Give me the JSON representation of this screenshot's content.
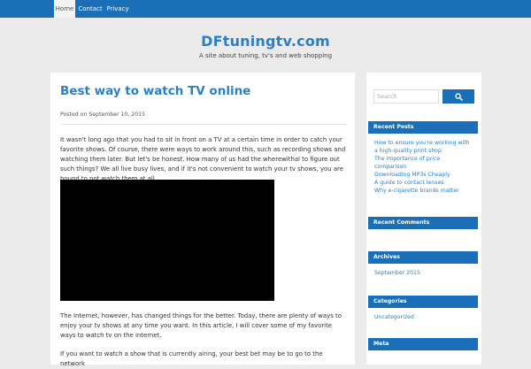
{
  "nav": {
    "items": [
      "Home",
      "Contact",
      "Privacy"
    ]
  },
  "site": {
    "title": "DFtuningtv.com",
    "description": "A site about tuning, tv's and web shopping"
  },
  "post": {
    "title": "Best way to watch TV online",
    "date": "Posted on September 10, 2015",
    "paragraphs": [
      "It wasn't long ago that you had to sit in front on a TV at a certain time in order to catch your favorite shows. Of course, there were ways to work around this, such as recording shows and watching them later. But let's be honest. How many of us had the wherewithal to figure out such things? We all live busy lives, and if it's not convenient to watch your tv shows, you are bound to not watch them at all.",
      "The Internet, however, has changed things for the better. Today, there are plenty of ways to enjoy your tv shows at any time you want. In this article, I will cover some of my favorite ways to watch tv on the internet.",
      "If you want to watch a show that is currently airing, your best bet may be to go to the network"
    ]
  },
  "sidebar": {
    "search_placeholder": "Search",
    "recent_posts": {
      "title": "Recent Posts",
      "items": [
        "How to ensure you're working with a high-quality print shop",
        "The importance of price comparison",
        "Downloading MP3s Cheaply",
        "A guide to contact lenses",
        "Why e-cigarette brands matter"
      ]
    },
    "recent_comments": {
      "title": "Recent Comments"
    },
    "archives": {
      "title": "Archives",
      "items": [
        "September 2015"
      ]
    },
    "categories": {
      "title": "Categories",
      "items": [
        "Uncategorized"
      ]
    },
    "meta": {
      "title": "Meta"
    }
  },
  "colors": {
    "accent": "#1b6fb8",
    "link": "#2b7fc7",
    "background": "#ebebeb"
  },
  "icons": {
    "search_button": "search-icon"
  }
}
